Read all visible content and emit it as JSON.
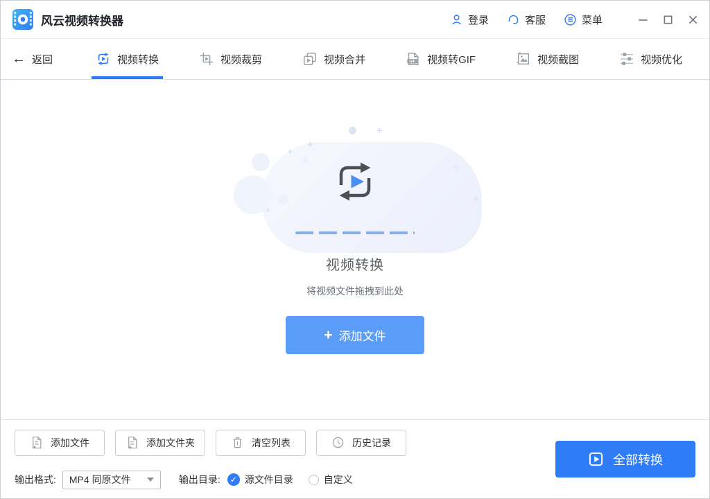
{
  "titlebar": {
    "app_title": "风云视频转换器",
    "login_label": "登录",
    "service_label": "客服",
    "menu_label": "菜单"
  },
  "tabbar": {
    "back_label": "返回",
    "active_tab": "视频转换",
    "tabs": [
      {
        "label": "视频转换"
      },
      {
        "label": "视频裁剪"
      },
      {
        "label": "视频合并"
      },
      {
        "label": "视频转GIF",
        "badge": "GIF"
      },
      {
        "label": "视频截图"
      },
      {
        "label": "视频优化"
      }
    ]
  },
  "dropzone": {
    "title": "视频转换",
    "hint": "将视频文件拖拽到此处",
    "add_button_label": "添加文件",
    "plus_glyph": "+"
  },
  "toolbar": {
    "buttons": [
      {
        "label": "添加文件"
      },
      {
        "label": "添加文件夹"
      },
      {
        "label": "清空列表"
      },
      {
        "label": "历史记录"
      }
    ]
  },
  "footer": {
    "format_label": "输出格式:",
    "format_value": "MP4 同原文件",
    "dir_label": "输出目录:",
    "dir_options": [
      {
        "label": "源文件目录",
        "selected": true
      },
      {
        "label": "自定义",
        "selected": false
      }
    ],
    "check_glyph": "✓",
    "convert_all_label": "全部转换"
  },
  "icons": {
    "app_logo": "film-reel",
    "user": "person-outline",
    "service": "headset",
    "menu": "circled-list",
    "minimize": "—",
    "maximize": "□",
    "close": "✕",
    "back": "←",
    "dropdown_caret": "▼"
  },
  "colors": {
    "accent": "#2F7CF6",
    "add_button": "#5B9CF8",
    "icon_gray": "#9aa0a6",
    "text_dark": "#333333",
    "text_muted": "#666666"
  }
}
